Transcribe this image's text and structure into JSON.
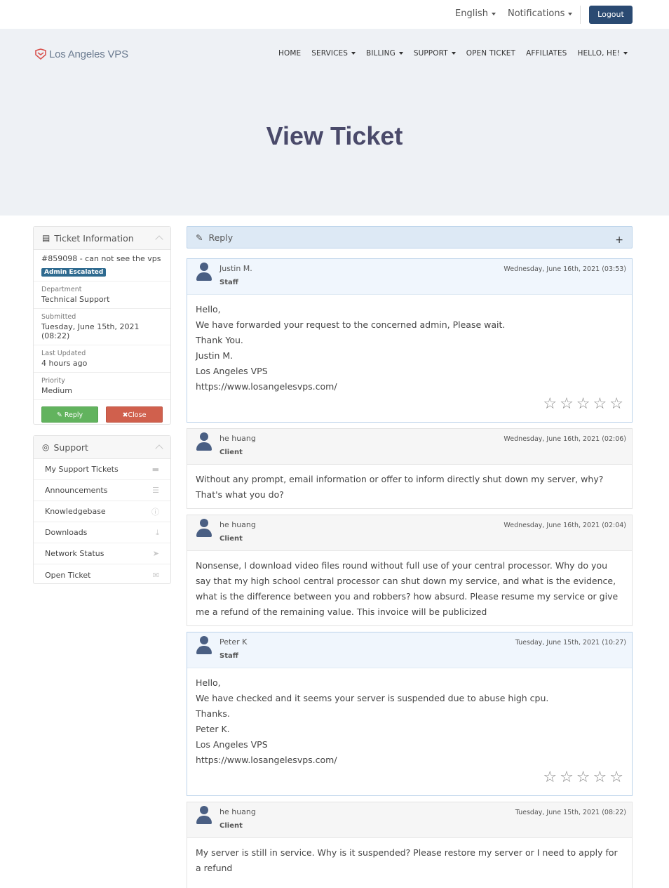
{
  "topbar": {
    "language": "English",
    "notifications": "Notifications",
    "logout": "Logout"
  },
  "brand": {
    "name": "Los Angeles VPS"
  },
  "nav": [
    {
      "label": "HOME",
      "dropdown": false
    },
    {
      "label": "SERVICES",
      "dropdown": true
    },
    {
      "label": "BILLING",
      "dropdown": true
    },
    {
      "label": "SUPPORT",
      "dropdown": true
    },
    {
      "label": "OPEN TICKET",
      "dropdown": false
    },
    {
      "label": "AFFILIATES",
      "dropdown": false
    },
    {
      "label": "HELLO, HE!",
      "dropdown": true
    }
  ],
  "page_title": "View Ticket",
  "ticket_info": {
    "title": "Ticket Information",
    "subject": "#859098 - can not see the vps",
    "status": "Admin Escalated",
    "department_label": "Department",
    "department": "Technical Support",
    "submitted_label": "Submitted",
    "submitted": "Tuesday, June 15th, 2021 (08:22)",
    "updated_label": "Last Updated",
    "updated": "4 hours ago",
    "priority_label": "Priority",
    "priority": "Medium",
    "reply_button": "Reply",
    "close_button": "Close"
  },
  "support": {
    "title": "Support",
    "items": [
      {
        "label": "My Support Tickets",
        "icon": "ticket-icon"
      },
      {
        "label": "Announcements",
        "icon": "list-icon"
      },
      {
        "label": "Knowledgebase",
        "icon": "info-icon"
      },
      {
        "label": "Downloads",
        "icon": "download-icon"
      },
      {
        "label": "Network Status",
        "icon": "rocket-icon"
      },
      {
        "label": "Open Ticket",
        "icon": "comments-icon"
      }
    ]
  },
  "reply_bar": {
    "label": "Reply",
    "toggle": "+"
  },
  "messages": [
    {
      "name": "Justin M.",
      "role": "Staff",
      "date": "Wednesday, June 16th, 2021 (03:53)",
      "lines": [
        "Hello,",
        "We have forwarded your request to the concerned admin, Please wait.",
        "Thank You.",
        "Justin M.",
        "Los Angeles VPS",
        "https://www.losangelesvps.com/"
      ],
      "rating_stars": 5
    },
    {
      "name": "he huang",
      "role": "Client",
      "date": "Wednesday, June 16th, 2021 (02:06)",
      "lines": [
        "Without any prompt, email information or offer to inform directly shut down my server, why? That's what you do?"
      ]
    },
    {
      "name": "he huang",
      "role": "Client",
      "date": "Wednesday, June 16th, 2021 (02:04)",
      "lines": [
        "Nonsense, I download video files round without full use of your central processor. Why do you say that my high school central processor can shut down my service, and what is the evidence, what is the difference between you and robbers? how absurd. Please resume my service or give me a refund of the remaining value. This invoice will be publicized"
      ]
    },
    {
      "name": "Peter K",
      "role": "Staff",
      "date": "Tuesday, June 15th, 2021 (10:27)",
      "lines": [
        "Hello,",
        "We have checked and it seems your server is suspended due to abuse high cpu.",
        "Thanks.",
        "Peter K.",
        "Los Angeles VPS",
        "https://www.losangelesvps.com/"
      ],
      "rating_stars": 5
    },
    {
      "name": "he huang",
      "role": "Client",
      "date": "Tuesday, June 15th, 2021 (08:22)",
      "lines": [
        "My server is still in service. Why is it suspended? Please restore my server or I need to apply for a refund"
      ]
    }
  ]
}
